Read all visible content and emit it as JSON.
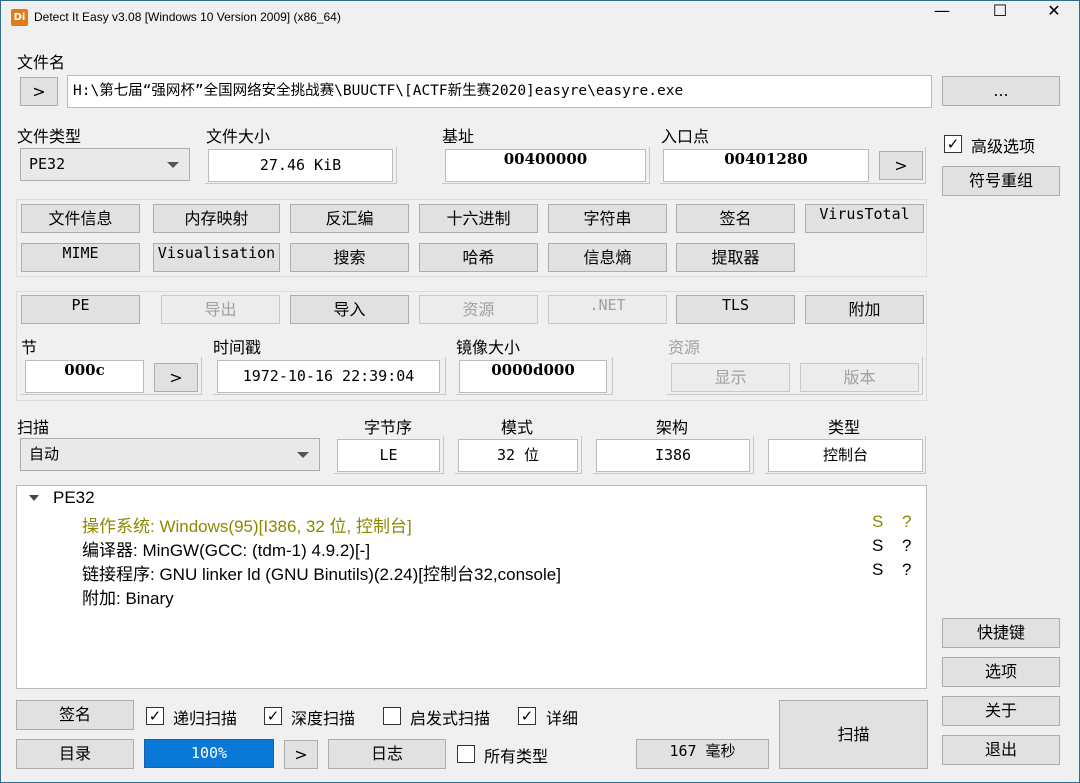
{
  "window": {
    "title": "Detect It Easy v3.08 [Windows 10 Version 2009] (x86_64)",
    "min": "—",
    "max": "☐",
    "close": "✕"
  },
  "file": {
    "label": "文件名",
    "go": ">",
    "path": "H:\\第七届“强网杯”全国网络安全挑战赛\\BUUCTF\\[ACTF新生赛2020]easyre\\easyre.exe",
    "browse": "..."
  },
  "info": {
    "type_label": "文件类型",
    "type_value": "PE32",
    "size_label": "文件大小",
    "size_value": "27.46 KiB",
    "base_label": "基址",
    "base_value": "00400000",
    "entry_label": "入口点",
    "entry_value": "00401280",
    "entry_go": ">"
  },
  "advanced": {
    "label": "高级选项",
    "checked": "✓",
    "symbols": "符号重组"
  },
  "tools": {
    "row1": [
      "文件信息",
      "内存映射",
      "反汇编",
      "十六进制",
      "字符串",
      "签名",
      "VirusTotal"
    ],
    "row2": [
      "MIME",
      "Visualisation",
      "搜索",
      "哈希",
      "信息熵",
      "提取器"
    ]
  },
  "pe": {
    "tabs": [
      "PE",
      "导出",
      "导入",
      "资源",
      ".NET",
      "TLS",
      "附加"
    ],
    "section_label": "节",
    "section_value": "000c",
    "section_go": ">",
    "timestamp_label": "时间戳",
    "timestamp_value": "1972-10-16 22:39:04",
    "image_size_label": "镜像大小",
    "image_size_value": "0000d000",
    "resources_label": "资源",
    "show": "显示",
    "version": "版本"
  },
  "scan": {
    "label": "扫描",
    "mode_value": "自动",
    "endian_label": "字节序",
    "endian_value": "LE",
    "mode_label": "模式",
    "bits_value": "32 位",
    "arch_label": "架构",
    "arch_value": "I386",
    "type_label": "类型",
    "type_value": "控制台"
  },
  "results": {
    "root": "PE32",
    "rows": [
      {
        "text": "操作系统: Windows(95)[I386, 32 位, 控制台]",
        "s": "S",
        "q": "?"
      },
      {
        "text": "编译器: MinGW(GCC: (tdm-1) 4.9.2)[-]",
        "s": "S",
        "q": "?"
      },
      {
        "text": "链接程序: GNU linker ld (GNU Binutils)(2.24)[控制台32,console]",
        "s": "S",
        "q": "?"
      },
      {
        "text": "附加: Binary",
        "s": "",
        "q": ""
      }
    ],
    "os_color": "#8a8a00"
  },
  "bottom": {
    "signature": "签名",
    "recursive": "递归扫描",
    "deep": "深度扫描",
    "heuristic": "启发式扫描",
    "verbose": "详细",
    "directory": "目录",
    "progress": "100%",
    "next": ">",
    "log": "日志",
    "all_types": "所有类型",
    "time": "167 毫秒",
    "scan": "扫描",
    "check": "✓"
  },
  "side": {
    "shortcuts": "快捷键",
    "options": "选项",
    "about": "关于",
    "exit": "退出"
  }
}
